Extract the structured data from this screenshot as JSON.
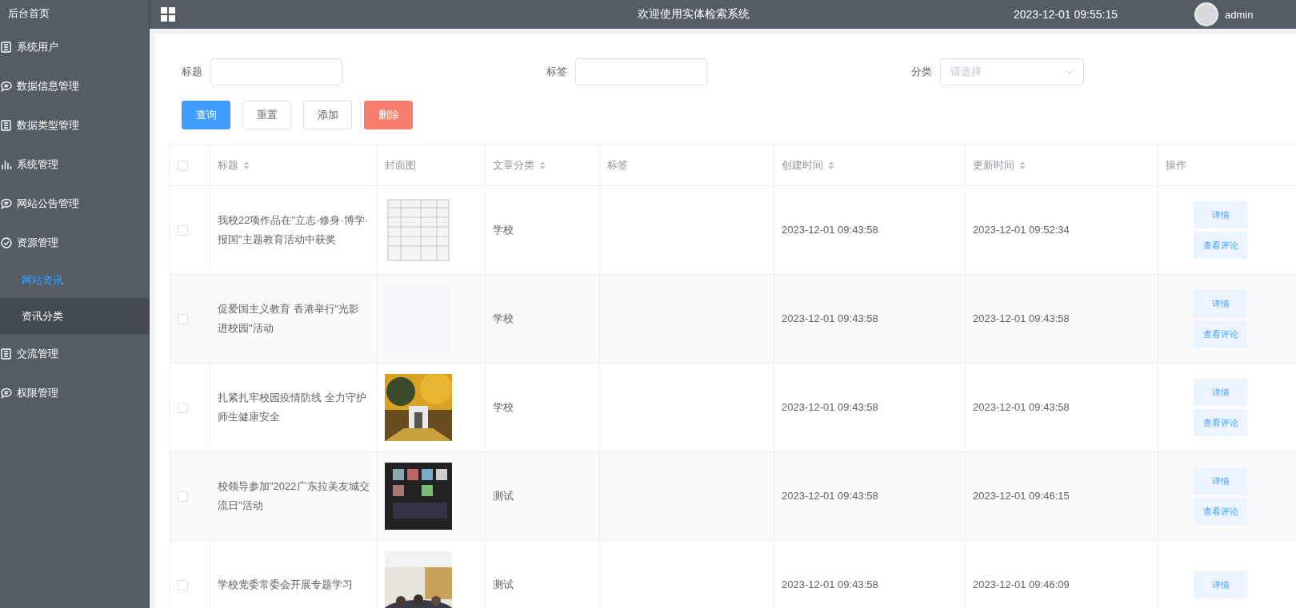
{
  "sidebar": {
    "home": "后台首页",
    "items": [
      {
        "label": "系统用户",
        "kind": "list"
      },
      {
        "label": "数据信息管理",
        "kind": "chat"
      },
      {
        "label": "数据类型管理",
        "kind": "list"
      },
      {
        "label": "系统管理",
        "kind": "chart"
      },
      {
        "label": "网站公告管理",
        "kind": "chat"
      },
      {
        "label": "资源管理",
        "kind": "check",
        "children": [
          {
            "label": "网站资讯",
            "selected": true,
            "hovered": false
          },
          {
            "label": "资讯分类",
            "selected": false,
            "hovered": true
          }
        ]
      },
      {
        "label": "交流管理",
        "kind": "list"
      },
      {
        "label": "权限管理",
        "kind": "chat"
      }
    ]
  },
  "header": {
    "title": "欢迎使用实体检索系统",
    "time": "2023-12-01 09:55:15",
    "user": "admin"
  },
  "filters": [
    {
      "label": "标题",
      "kind": "input"
    },
    {
      "label": "标签",
      "kind": "input"
    },
    {
      "label": "分类",
      "kind": "select",
      "placeholder": "请选择"
    }
  ],
  "actions": [
    {
      "label": "查询",
      "kind": "primary"
    },
    {
      "label": "重置",
      "kind": "plain"
    },
    {
      "label": "添加",
      "kind": "plain"
    },
    {
      "label": "删除",
      "kind": "danger"
    }
  ],
  "table": {
    "select_all": {
      "checked": false
    },
    "columns": [
      {
        "label": "标题",
        "sortable": true
      },
      {
        "label": "封面图",
        "sortable": false
      },
      {
        "label": "文章分类",
        "sortable": true
      },
      {
        "label": "标签",
        "sortable": false
      },
      {
        "label": "创建时间",
        "sortable": true
      },
      {
        "label": "更新时间",
        "sortable": true
      },
      {
        "label": "操作",
        "sortable": false
      }
    ],
    "rows": [
      {
        "checked": false,
        "title": "我校22项作品在\"立志·修身·博学·报国\"主题教育活动中获奖",
        "cover": {
          "kind": "picture"
        },
        "category": "学校",
        "created": "2023-12-01 09:43:58",
        "updated": "2023-12-01 09:52:34",
        "buttons": [
          "详情",
          "查看评论"
        ]
      },
      {
        "checked": false,
        "title": "促爱国主义教育 香港举行\"光影进校园\"活动",
        "cover": {
          "kind": "empty"
        },
        "category": "学校",
        "created": "2023-12-01 09:43:58",
        "updated": "2023-12-01 09:43:58",
        "buttons": [
          "详情",
          "查看评论"
        ]
      },
      {
        "checked": false,
        "title": "扎紧扎牢校园疫情防线 全力守护师生健康安全",
        "cover": {
          "kind": "picture"
        },
        "category": "学校",
        "created": "2023-12-01 09:43:58",
        "updated": "2023-12-01 09:43:58",
        "buttons": [
          "详情",
          "查看评论"
        ]
      },
      {
        "checked": false,
        "title": "校领导参加\"2022广东拉美友城交流日\"活动",
        "cover": {
          "kind": "picture"
        },
        "category": "测试",
        "created": "2023-12-01 09:43:58",
        "updated": "2023-12-01 09:46:15",
        "buttons": [
          "详情",
          "查看评论"
        ]
      },
      {
        "checked": false,
        "title": "学校党委常委会开展专题学习",
        "cover": {
          "kind": "picture"
        },
        "category": "测试",
        "created": "2023-12-01 09:43:58",
        "updated": "2023-12-01 09:46:09",
        "buttons": [
          "详情"
        ]
      }
    ]
  }
}
